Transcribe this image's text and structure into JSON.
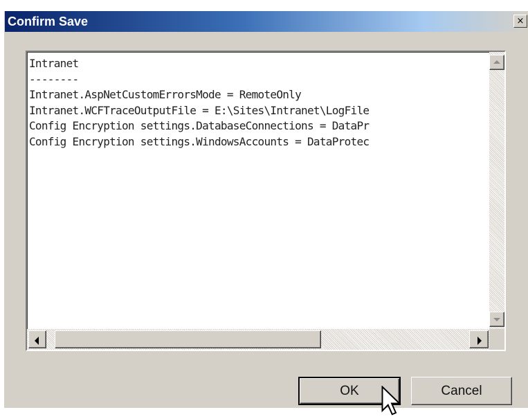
{
  "dialog": {
    "title": "Confirm Save",
    "close_glyph": "×"
  },
  "textbox": {
    "lines": [
      "Intranet",
      "--------",
      "Intranet.AspNetCustomErrorsMode = RemoteOnly",
      "Intranet.WCFTraceOutputFile = E:\\Sites\\Intranet\\LogFile",
      "Config Encryption settings.DatabaseConnections = DataPr",
      "Config Encryption settings.WindowsAccounts = DataProtec"
    ]
  },
  "buttons": {
    "ok_label": "OK",
    "cancel_label": "Cancel"
  },
  "icons": {
    "cursor": "mouse-pointer-icon",
    "close": "close-icon"
  }
}
